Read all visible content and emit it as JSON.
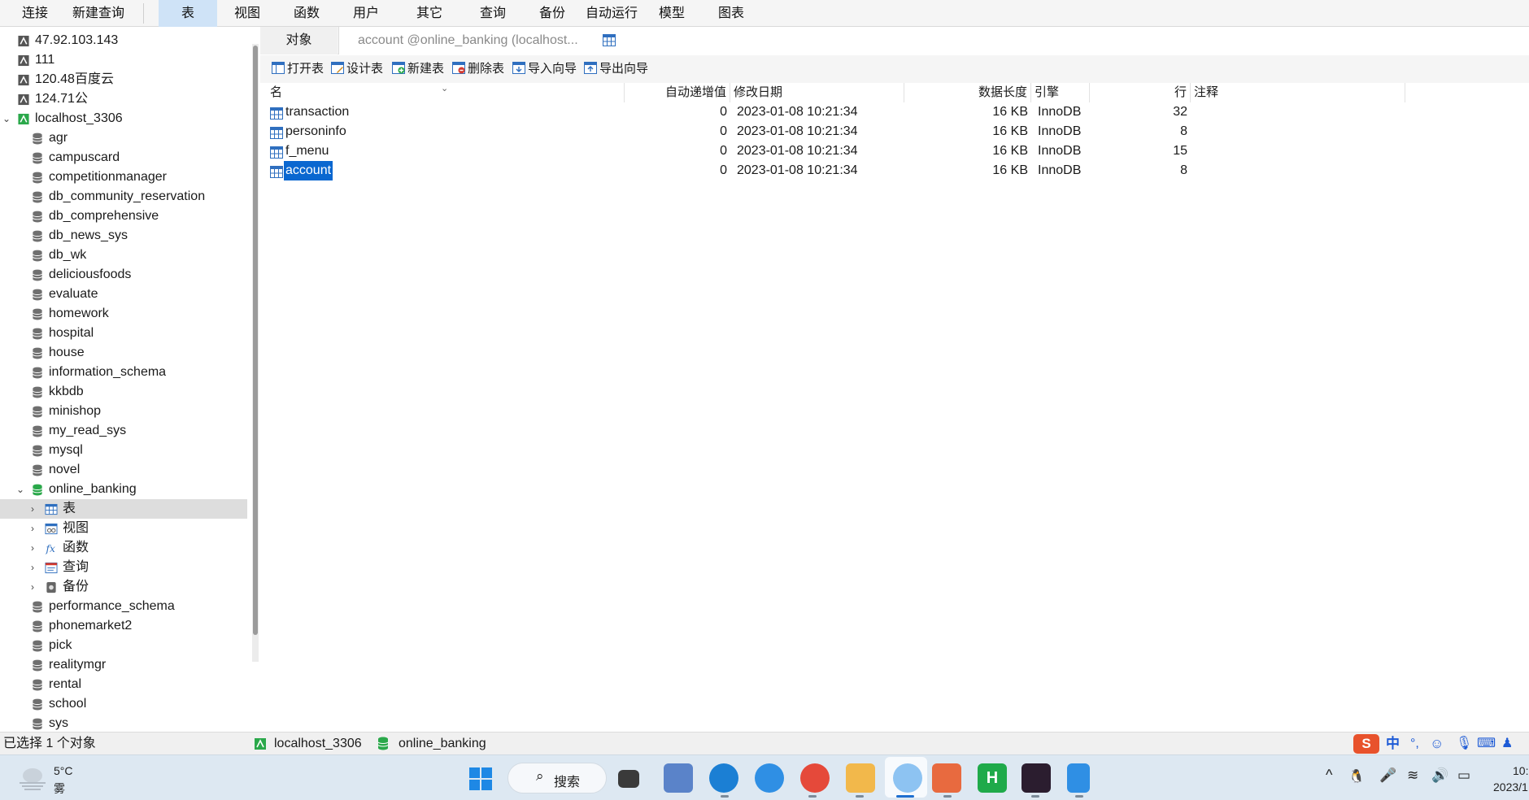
{
  "menu": {
    "items": [
      "连接",
      "新建查询",
      "表",
      "视图",
      "函数",
      "用户",
      "其它",
      "查询",
      "备份",
      "自动运行",
      "模型",
      "图表"
    ],
    "active_index": 2
  },
  "sidebar": {
    "connections": [
      "47.92.103.143",
      "111",
      "120.48百度云",
      "124.71公"
    ],
    "local_connection": "localhost_3306",
    "databases_before": [
      "agr",
      "campuscard",
      "competitionmanager",
      "db_community_reservation",
      "db_comprehensive",
      "db_news_sys",
      "db_wk",
      "deliciousfoods",
      "evaluate",
      "homework",
      "hospital",
      "house",
      "information_schema",
      "kkbdb",
      "minishop",
      "my_read_sys",
      "mysql",
      "novel"
    ],
    "open_database": "online_banking",
    "open_database_children": [
      "表",
      "视图",
      "函数",
      "查询",
      "备份"
    ],
    "databases_after": [
      "performance_schema",
      "phonemarket2",
      "pick",
      "realitymgr",
      "rental",
      "school",
      "sys"
    ]
  },
  "tabs": {
    "objects_label": "对象",
    "document_label": "account @online_banking (localhost..."
  },
  "toolbar": {
    "open_table": "打开表",
    "design_table": "设计表",
    "new_table": "新建表",
    "delete_table": "删除表",
    "import_wizard": "导入向导",
    "export_wizard": "导出向导"
  },
  "table_list": {
    "columns": [
      "名",
      "自动递增值",
      "修改日期",
      "数据长度",
      "引擎",
      "行",
      "注释"
    ],
    "rows": [
      {
        "name": "transaction",
        "auto_increment": "0",
        "modified": "2023-01-08 10:21:34",
        "data_length": "16 KB",
        "engine": "InnoDB",
        "rows": "32",
        "comment": ""
      },
      {
        "name": "personinfo",
        "auto_increment": "0",
        "modified": "2023-01-08 10:21:34",
        "data_length": "16 KB",
        "engine": "InnoDB",
        "rows": "8",
        "comment": ""
      },
      {
        "name": "f_menu",
        "auto_increment": "0",
        "modified": "2023-01-08 10:21:34",
        "data_length": "16 KB",
        "engine": "InnoDB",
        "rows": "15",
        "comment": ""
      },
      {
        "name": "account",
        "auto_increment": "0",
        "modified": "2023-01-08 10:21:34",
        "data_length": "16 KB",
        "engine": "InnoDB",
        "rows": "8",
        "comment": ""
      }
    ],
    "selected_index": 3
  },
  "statusbar": {
    "selection": "已选择 1 个对象",
    "connection": "localhost_3306",
    "database": "online_banking"
  },
  "taskbar": {
    "weather_temp": "5°C",
    "weather_desc": "雾",
    "search_label": "搜索",
    "ime_label": "中",
    "clock_time": "10:",
    "clock_date": "2023/1"
  },
  "colors": {
    "selection_blue": "#0a67d0",
    "active_menu": "#cfe3f7",
    "db_green": "#2aa84a"
  }
}
